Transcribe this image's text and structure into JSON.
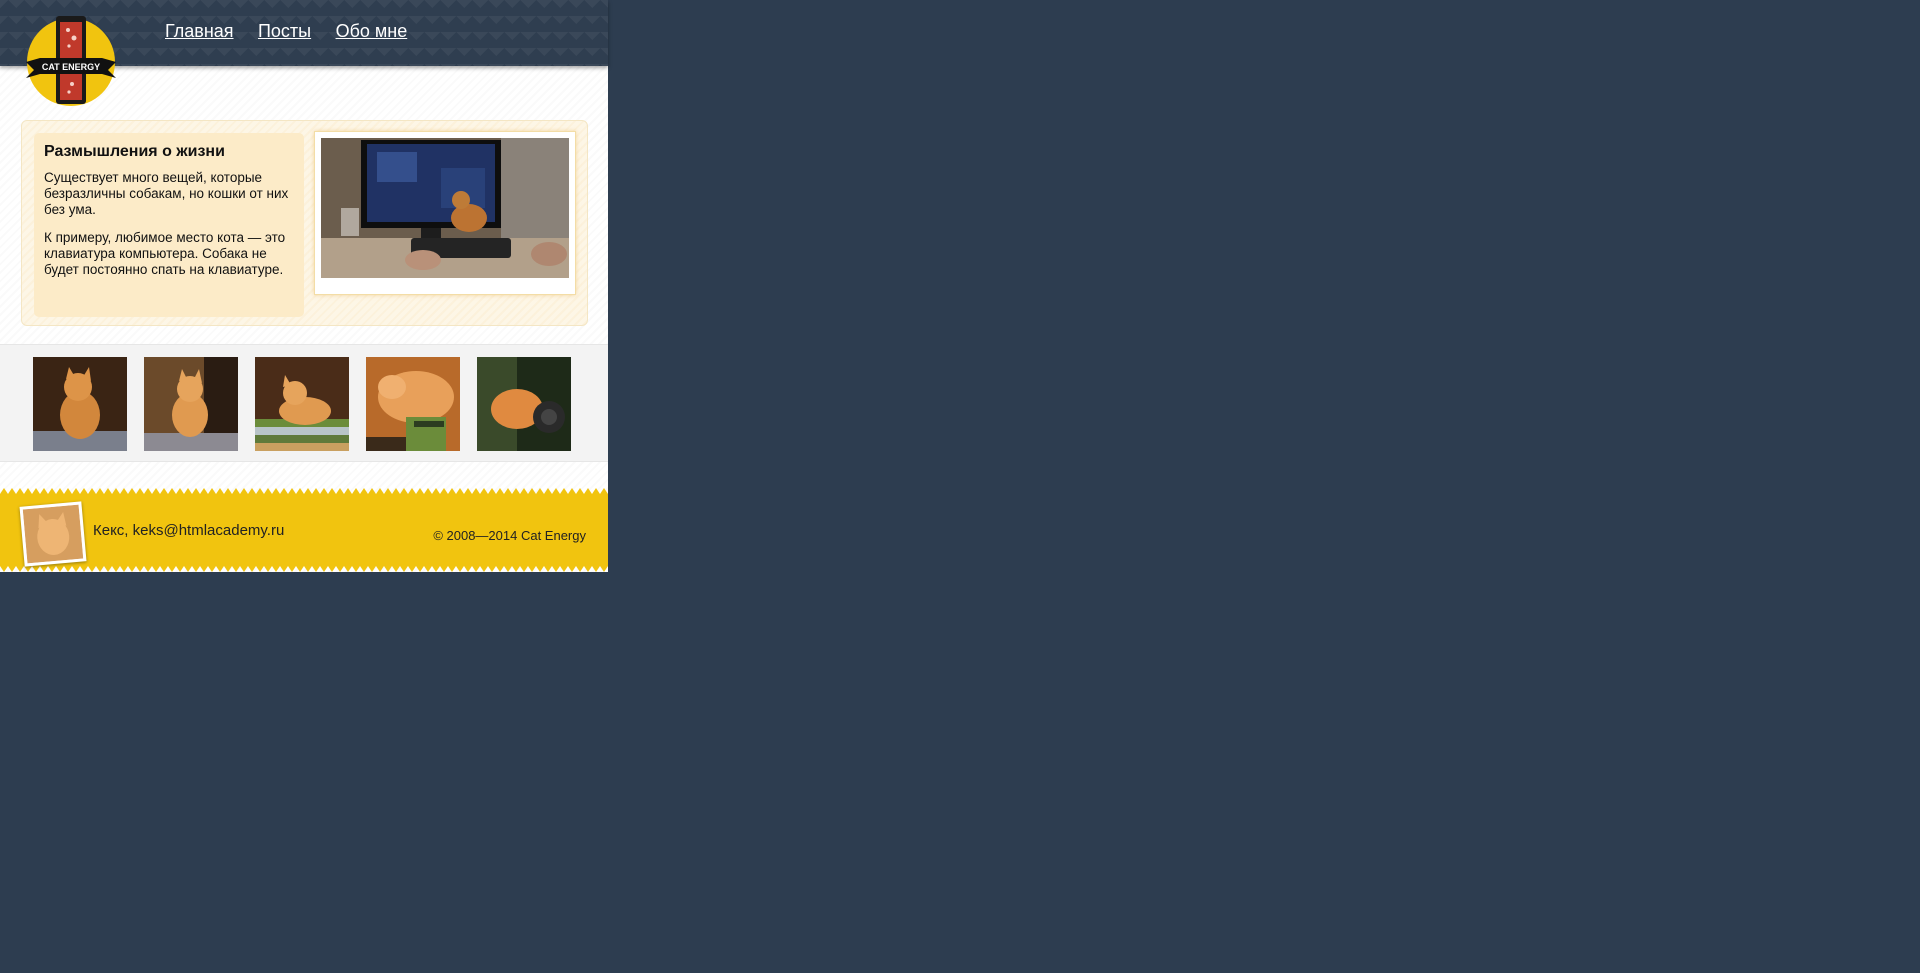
{
  "brand": {
    "logo_text": "CAT ENERGY",
    "accent": "#f1c40f",
    "header_bg": "#2f3e50",
    "page_bg": "#2d3d50"
  },
  "nav": {
    "items": [
      {
        "label": "Главная"
      },
      {
        "label": "Посты"
      },
      {
        "label": "Обо мне"
      }
    ]
  },
  "article": {
    "title": "Размышления о жизни",
    "paragraphs": [
      "Существует много вещей, которые безразличны собакам, но кошки от них без ума.",
      "К примеру, любимое место кота — это клавиатура компьютера. Собака не будет постоянно спать на клавиатуре."
    ],
    "photo_icon": "cat-on-keyboard-photo"
  },
  "gallery": {
    "thumbs": [
      {
        "icon": "kitten-photo-1"
      },
      {
        "icon": "kitten-photo-2"
      },
      {
        "icon": "kitten-photo-3"
      },
      {
        "icon": "kitten-photo-4"
      },
      {
        "icon": "kitten-photo-5"
      }
    ]
  },
  "footer": {
    "author": "Кекс, keks@htmlacademy.ru",
    "copyright": "© 2008—2014 Cat Energy",
    "avatar_icon": "cat-avatar-photo",
    "bg_color": "#f1c40f"
  }
}
